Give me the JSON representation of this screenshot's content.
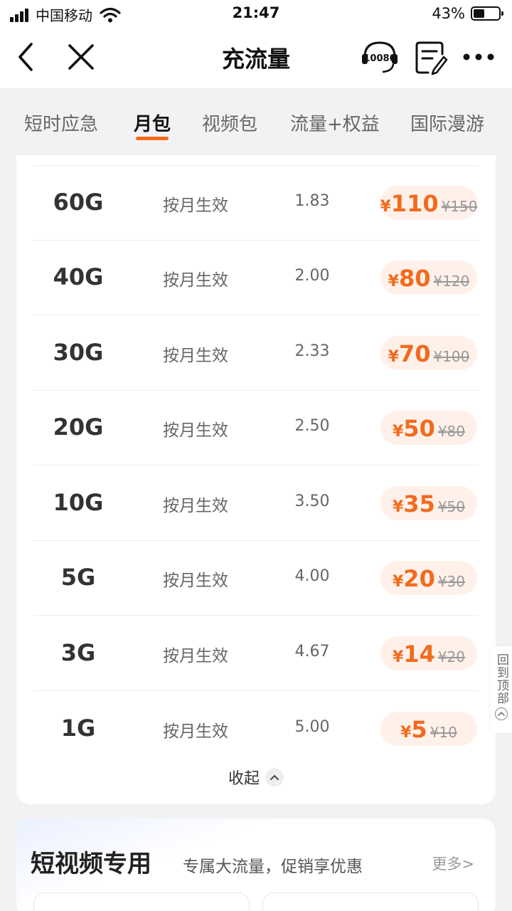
{
  "status_bar": {
    "carrier": "中国移动",
    "time": "21:47",
    "battery": "43%",
    "battery_level": 0.43
  },
  "nav": {
    "title": "充流量",
    "service_number": "10086"
  },
  "tabs": [
    {
      "label": "短时应急",
      "active": false
    },
    {
      "label": "月包",
      "active": true
    },
    {
      "label": "视频包",
      "active": false
    },
    {
      "label": "流量+权益",
      "active": false
    },
    {
      "label": "国际漫游",
      "active": false
    }
  ],
  "packages": [
    {
      "size": "60G",
      "effect": "按月生效",
      "unit_price": "1.83",
      "currency": "¥",
      "price": "110",
      "original": "¥150"
    },
    {
      "size": "40G",
      "effect": "按月生效",
      "unit_price": "2.00",
      "currency": "¥",
      "price": "80",
      "original": "¥120"
    },
    {
      "size": "30G",
      "effect": "按月生效",
      "unit_price": "2.33",
      "currency": "¥",
      "price": "70",
      "original": "¥100"
    },
    {
      "size": "20G",
      "effect": "按月生效",
      "unit_price": "2.50",
      "currency": "¥",
      "price": "50",
      "original": "¥80"
    },
    {
      "size": "10G",
      "effect": "按月生效",
      "unit_price": "3.50",
      "currency": "¥",
      "price": "35",
      "original": "¥50"
    },
    {
      "size": "5G",
      "effect": "按月生效",
      "unit_price": "4.00",
      "currency": "¥",
      "price": "20",
      "original": "¥30"
    },
    {
      "size": "3G",
      "effect": "按月生效",
      "unit_price": "4.67",
      "currency": "¥",
      "price": "14",
      "original": "¥20"
    },
    {
      "size": "1G",
      "effect": "按月生效",
      "unit_price": "5.00",
      "currency": "¥",
      "price": "5",
      "original": "¥10"
    }
  ],
  "collapse_label": "收起",
  "back_to_top": "回到顶部",
  "section2": {
    "title": "短视频专用",
    "subtitle": "专属大流量，促销享优惠",
    "more": "更多>"
  },
  "colors": {
    "accent": "#f26b1d",
    "price_bg": "#fff1ea",
    "page_bg": "#f2f2f4"
  },
  "icons": [
    "back-icon",
    "close-icon",
    "customer-service-icon",
    "order-note-icon",
    "more-icon",
    "chevron-up-icon",
    "wifi-icon",
    "signal-icon",
    "battery-icon"
  ]
}
